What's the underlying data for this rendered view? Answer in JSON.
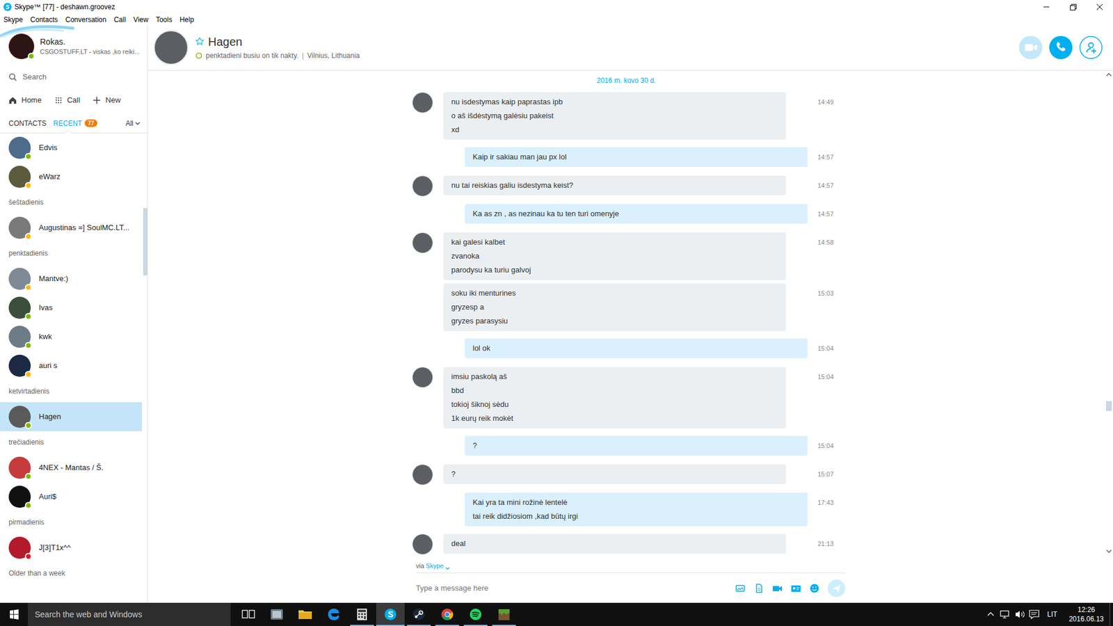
{
  "window": {
    "title": "Skype™ [77] - deshawn.groovez"
  },
  "menu": [
    "Skype",
    "Contacts",
    "Conversation",
    "Call",
    "View",
    "Tools",
    "Help"
  ],
  "profile": {
    "name": "Rokas.",
    "mood": "CSGOSTUFF.LT - viskas ,ko reiki...",
    "color": "#7fba00"
  },
  "search": {
    "placeholder": "Search"
  },
  "nav": [
    {
      "kind": "home",
      "label": "Home"
    },
    {
      "kind": "call",
      "label": "Call"
    },
    {
      "kind": "new",
      "label": "New"
    }
  ],
  "tabs": [
    {
      "label": "CONTACTS",
      "selected": false,
      "badge": ""
    },
    {
      "label": "RECENT",
      "selected": true,
      "badge": "77"
    }
  ],
  "filter": "All",
  "contacts": [
    {
      "kind": "contact",
      "name": "Edvis",
      "color": "#7fba00",
      "selected": false
    },
    {
      "kind": "contact",
      "name": "eWarz",
      "color": "#fdb913",
      "selected": false
    },
    {
      "kind": "header",
      "label": "šeštadienis"
    },
    {
      "kind": "contact",
      "name": "Augustinas =] SoulMC.LT...",
      "color": "#fdb913",
      "selected": false
    },
    {
      "kind": "header",
      "label": "penktadienis"
    },
    {
      "kind": "contact",
      "name": "Mantve:)",
      "color": "#fdb913",
      "selected": false
    },
    {
      "kind": "contact",
      "name": "Ivas",
      "color": "#7fba00",
      "selected": false
    },
    {
      "kind": "contact",
      "name": "kwk",
      "color": "#7fba00",
      "selected": false
    },
    {
      "kind": "contact",
      "name": "auri s",
      "color": "#fdb913",
      "selected": false
    },
    {
      "kind": "header",
      "label": "ketvirtadienis"
    },
    {
      "kind": "contact",
      "name": "Hagen",
      "color": "#7fba00",
      "selected": true
    },
    {
      "kind": "header",
      "label": "trečiadienis"
    },
    {
      "kind": "contact",
      "name": "4NEX - Mantas / Š.",
      "color": "#7fba00",
      "selected": false
    },
    {
      "kind": "contact",
      "name": "Auri$",
      "color": "#7fba00",
      "selected": false
    },
    {
      "kind": "header",
      "label": "pirmadienis"
    },
    {
      "kind": "contact",
      "name": "J[3]T1x^^",
      "color": "#e81123",
      "selected": false
    },
    {
      "kind": "header",
      "label": "Older than a week"
    }
  ],
  "conversation": {
    "name": "Hagen",
    "favorite": false,
    "mood": "penktadieni busiu on tik nakty.",
    "separator": "|",
    "location": "Vilnius, Lithuania"
  },
  "call_buttons": [
    {
      "kind": "video",
      "disabled": true
    },
    {
      "kind": "call",
      "disabled": false
    },
    {
      "kind": "add-contact",
      "disabled": false
    }
  ],
  "date": "2016 m. kovo 30 d.",
  "messages": [
    {
      "kind": "incoming",
      "show_avatar": true,
      "time": "14:49",
      "lines": [
        "nu isdestymas kaip paprastas ipb",
        "o aš išdėstymą galėsiu pakeist",
        "xd"
      ]
    },
    {
      "kind": "outgoing",
      "show_avatar": false,
      "time": "14:57",
      "lines": [
        "Kaip ir sakiau man jau px lol"
      ]
    },
    {
      "kind": "incoming",
      "show_avatar": true,
      "time": "14:57",
      "lines": [
        "nu tai reiskias galiu isdestyma keist?"
      ]
    },
    {
      "kind": "outgoing",
      "show_avatar": false,
      "time": "14:57",
      "lines": [
        "Ka as zn , as nezinau ka tu ten turi omenyje"
      ]
    },
    {
      "kind": "incoming",
      "show_avatar": true,
      "time": "14:58",
      "lines": [
        "kai galesi kalbet",
        "zvanoka",
        "parodysu ka turiu galvoj"
      ]
    },
    {
      "kind": "incoming",
      "show_avatar": false,
      "time": "15:03",
      "lines": [
        "soku iki menturines",
        "gryzesp a",
        "gryzes parasysiu"
      ]
    },
    {
      "kind": "outgoing",
      "show_avatar": false,
      "time": "15:04",
      "lines": [
        "lol ok"
      ]
    },
    {
      "kind": "incoming",
      "show_avatar": true,
      "time": "15:04",
      "lines": [
        "imsiu paskolą aš",
        "bbd",
        "tokioj šiknoj sėdu",
        "1k eurų reik mokėt"
      ]
    },
    {
      "kind": "outgoing",
      "show_avatar": false,
      "time": "15:04",
      "lines": [
        "?"
      ]
    },
    {
      "kind": "incoming",
      "show_avatar": true,
      "time": "15:07",
      "lines": [
        "?"
      ]
    },
    {
      "kind": "outgoing",
      "show_avatar": false,
      "time": "17:43",
      "lines": [
        "Kai yra ta mini rožinė lentelė",
        "tai reik didžiosiom ,kad būtų irgi"
      ]
    },
    {
      "kind": "incoming",
      "show_avatar": true,
      "time": "21:13",
      "lines": [
        "deal"
      ]
    }
  ],
  "compose": {
    "via": "via",
    "network": "Skype",
    "placeholder": "Type a message here"
  },
  "taskbar": {
    "search_placeholder": "Search the web and Windows",
    "apps": [
      {
        "kind": "task-view",
        "running": false,
        "active": false
      },
      {
        "kind": "app",
        "running": false,
        "active": false
      },
      {
        "kind": "explorer",
        "running": false,
        "active": false
      },
      {
        "kind": "edge",
        "running": false,
        "active": false
      },
      {
        "kind": "calculator",
        "running": true,
        "active": false
      },
      {
        "kind": "skype",
        "running": true,
        "active": true
      },
      {
        "kind": "steam",
        "running": true,
        "active": false
      },
      {
        "kind": "chrome",
        "running": true,
        "active": false
      },
      {
        "kind": "spotify",
        "running": true,
        "active": false
      },
      {
        "kind": "minecraft",
        "running": true,
        "active": false
      }
    ],
    "language": "LIT",
    "time": "12:26",
    "date": "2016.06.13"
  }
}
